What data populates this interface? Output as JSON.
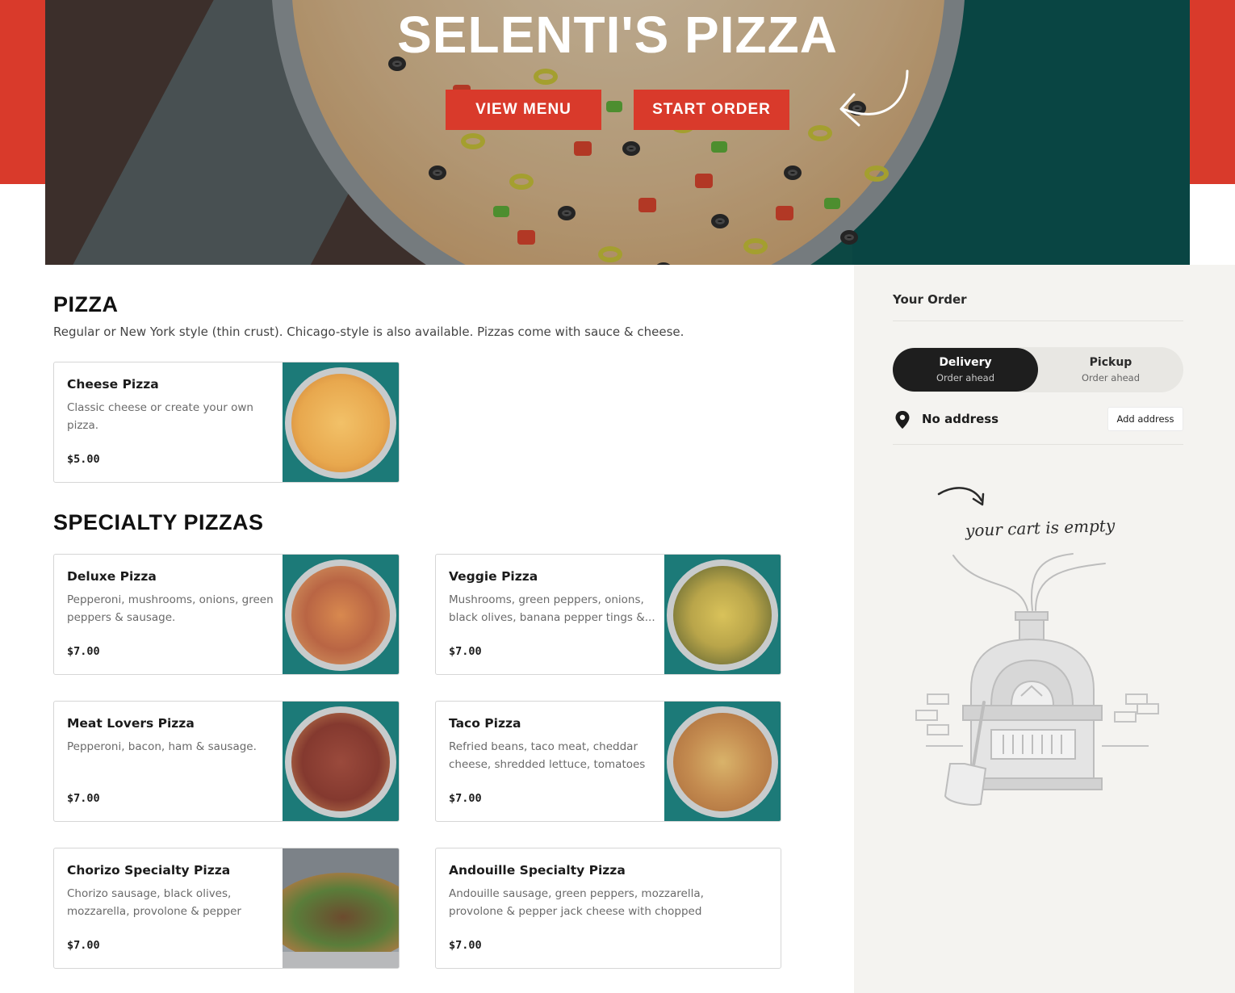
{
  "hero": {
    "title": "SELENTI'S PIZZA",
    "view_menu_label": "VIEW MENU",
    "start_order_label": "START ORDER"
  },
  "sections": [
    {
      "title": "PIZZA",
      "description": "Regular or New York style (thin crust). Chicago-style is also available. Pizzas come with sauce & cheese.",
      "items": [
        {
          "name": "Cheese Pizza",
          "description": "Classic cheese or create your own pizza.",
          "price": "$5.00"
        }
      ]
    },
    {
      "title": "SPECIALTY PIZZAS",
      "items": [
        {
          "name": "Deluxe Pizza",
          "description": "Pepperoni, mushrooms, onions, green peppers & sausage.",
          "price": "$7.00"
        },
        {
          "name": "Veggie Pizza",
          "description": "Mushrooms, green peppers, onions, black olives, banana pepper tings &...",
          "price": "$7.00"
        },
        {
          "name": "Meat Lovers Pizza",
          "description": "Pepperoni, bacon, ham & sausage.",
          "price": "$7.00"
        },
        {
          "name": "Taco Pizza",
          "description": "Refried beans, taco meat, cheddar cheese, shredded lettuce, tomatoes &...",
          "price": "$7.00"
        },
        {
          "name": "Chorizo Specialty Pizza",
          "description": "Chorizo sausage, black olives, mozzarella, provolone & pepper jack...",
          "price": "$7.00"
        },
        {
          "name": "Andouille Specialty Pizza",
          "description": "Andouille sausage, green peppers, mozzarella, provolone & pepper jack cheese with chopped tomatoes.",
          "price": "$7.00"
        }
      ]
    }
  ],
  "order": {
    "title": "Your Order",
    "delivery": {
      "label": "Delivery",
      "sub": "Order ahead"
    },
    "pickup": {
      "label": "Pickup",
      "sub": "Order ahead"
    },
    "address_text": "No address",
    "add_address_label": "Add address",
    "empty_cart_text": "your cart is empty"
  },
  "icons": {
    "location": "location-pin-icon",
    "arrow": "hand-drawn-arrow-icon",
    "oven": "pizza-oven-illustration"
  },
  "colors": {
    "brand_red": "#d93a2b",
    "dark_toggle": "#1e1e1e",
    "sidebar_bg": "#f4f3f0"
  }
}
